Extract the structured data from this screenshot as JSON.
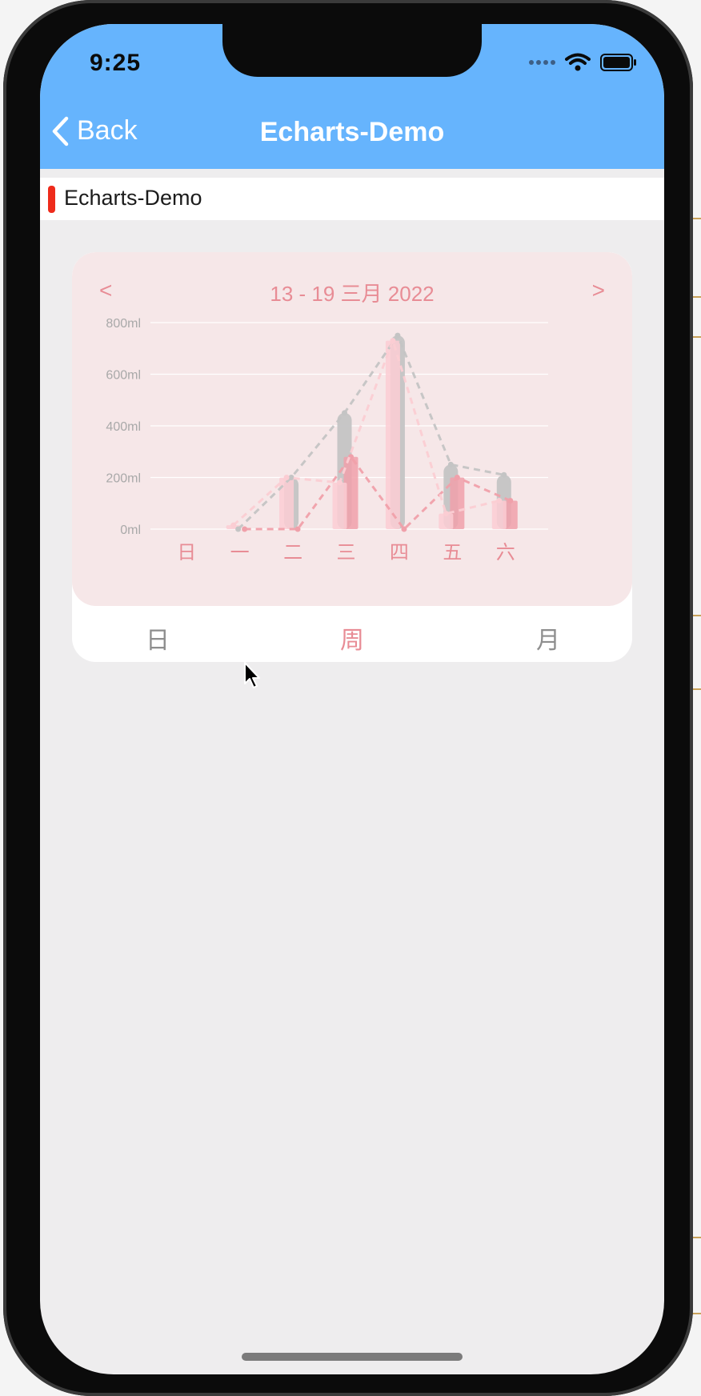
{
  "status_bar": {
    "time": "9:25",
    "icons": [
      "cellular-dots-icon",
      "wifi-icon",
      "battery-icon"
    ]
  },
  "nav": {
    "back_label": "Back",
    "title": "Echarts-Demo"
  },
  "section": {
    "title": "Echarts-Demo"
  },
  "chart_nav": {
    "prev": "<",
    "next": ">",
    "date_range": "13 - 19 三月 2022"
  },
  "tabs": [
    {
      "label": "日",
      "active": false
    },
    {
      "label": "周",
      "active": true
    },
    {
      "label": "月",
      "active": false
    }
  ],
  "colors": {
    "header": "#66b4fd",
    "accent_red": "#ee2b1b",
    "chart_pink": "#e88c95",
    "chart_gray": "#c4c4c4"
  },
  "chart_data": {
    "type": "bar",
    "categories": [
      "日",
      "一",
      "二",
      "三",
      "四",
      "五",
      "六"
    ],
    "y_ticks": [
      "0ml",
      "200ml",
      "400ml",
      "600ml",
      "800ml"
    ],
    "ylim": [
      0,
      800
    ],
    "grid": true,
    "series": [
      {
        "color": "#c4c4c4",
        "style": "bar+dashed-line",
        "values": [
          0,
          0,
          200,
          450,
          750,
          250,
          210
        ]
      },
      {
        "color": "#f0a0aa",
        "style": "bar+dashed-line",
        "values": [
          0,
          0,
          0,
          280,
          0,
          200,
          110
        ]
      },
      {
        "color": "#fbcdd3",
        "style": "bar+dashed-line",
        "values": [
          0,
          15,
          200,
          180,
          730,
          60,
          110
        ]
      }
    ]
  }
}
